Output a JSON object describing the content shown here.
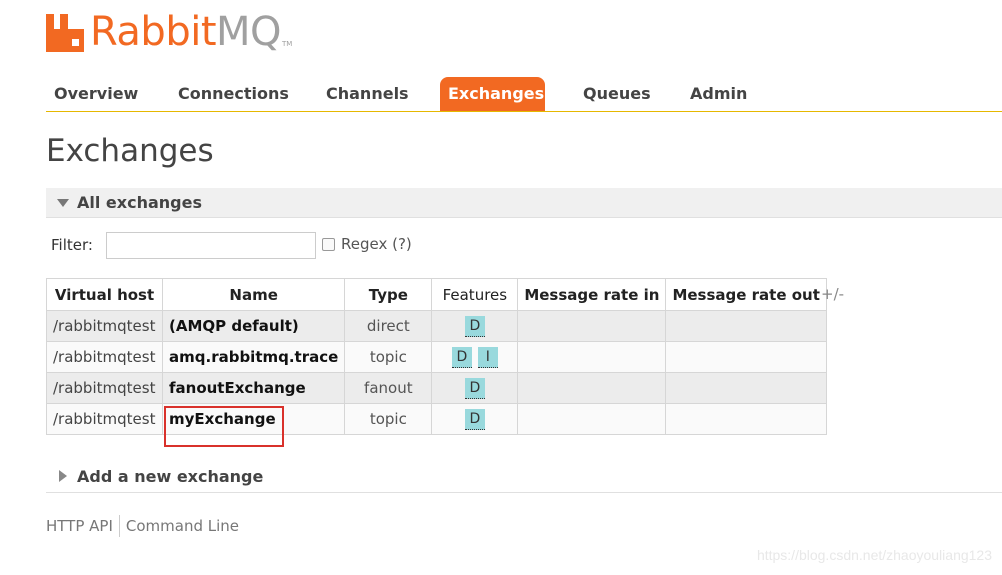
{
  "logo": {
    "text_rabbit": "Rabbit",
    "text_mq": "MQ",
    "tm": "TM"
  },
  "nav": {
    "tabs": [
      {
        "label": "Overview"
      },
      {
        "label": "Connections"
      },
      {
        "label": "Channels"
      },
      {
        "label": "Exchanges",
        "active": true
      },
      {
        "label": "Queues"
      },
      {
        "label": "Admin"
      }
    ]
  },
  "page": {
    "title": "Exchanges"
  },
  "all_exchanges": {
    "section_label": "All exchanges",
    "filter_label": "Filter:",
    "filter_value": "",
    "regex_label": "Regex (?)",
    "plus_minus": "+/-",
    "columns": [
      "Virtual host",
      "Name",
      "Type",
      "Features",
      "Message rate in",
      "Message rate out"
    ],
    "rows": [
      {
        "vhost": "/rabbitmqtest",
        "name": "(AMQP default)",
        "type": "direct",
        "features": [
          "D"
        ],
        "rate_in": "",
        "rate_out": ""
      },
      {
        "vhost": "/rabbitmqtest",
        "name": "amq.rabbitmq.trace",
        "type": "topic",
        "features": [
          "D",
          "I"
        ],
        "rate_in": "",
        "rate_out": ""
      },
      {
        "vhost": "/rabbitmqtest",
        "name": "fanoutExchange",
        "type": "fanout",
        "features": [
          "D"
        ],
        "rate_in": "",
        "rate_out": ""
      },
      {
        "vhost": "/rabbitmqtest",
        "name": "myExchange",
        "type": "topic",
        "features": [
          "D"
        ],
        "rate_in": "",
        "rate_out": ""
      }
    ]
  },
  "add_exchange": {
    "label": "Add a new exchange"
  },
  "footer": {
    "links": [
      "HTTP API",
      "Command Line"
    ]
  },
  "watermark": "https://blog.csdn.net/zhaoyouliang123",
  "colors": {
    "accent": "#f26922",
    "badge": "#99d9dd",
    "highlight": "#d9312b"
  }
}
